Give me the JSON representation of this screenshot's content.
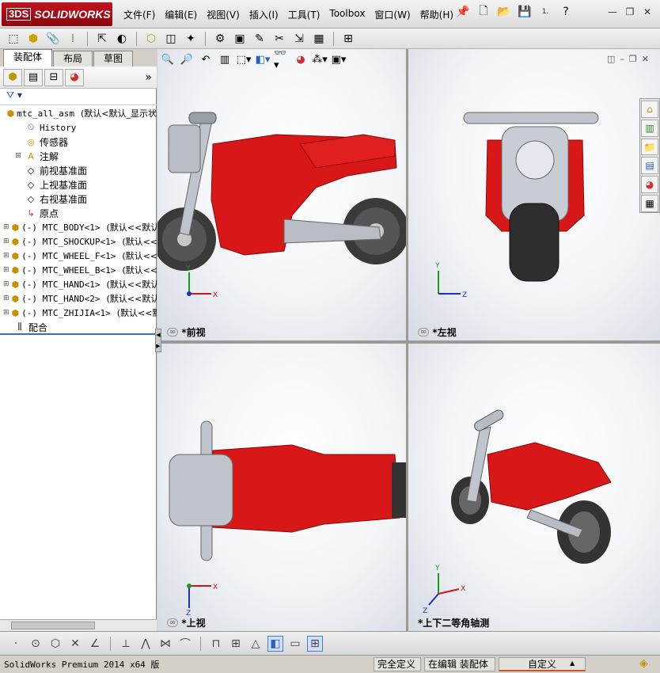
{
  "app": {
    "logo_ds": "3DS",
    "logo_text": "SOLIDWORKS"
  },
  "menu": [
    "文件(F)",
    "编辑(E)",
    "视图(V)",
    "插入(I)",
    "工具(T)",
    "Toolbox",
    "窗口(W)",
    "帮助(H)"
  ],
  "menu_extra": "1.",
  "panel": {
    "tabs": [
      "装配体",
      "布局",
      "草图"
    ],
    "more": "»",
    "tree": [
      {
        "name": "mtc_all_asm",
        "cfg": "(默认<默认_显示状",
        "expand": "",
        "icon": "assembly-icon",
        "mono": true
      },
      {
        "name": "History",
        "cfg": "",
        "expand": "",
        "icon": "history-icon",
        "mono": true,
        "indent": 1
      },
      {
        "name": "传感器",
        "cfg": "",
        "expand": "",
        "icon": "sensor-icon",
        "indent": 1
      },
      {
        "name": "注解",
        "cfg": "",
        "expand": "⊞",
        "icon": "annotation-icon",
        "indent": 1
      },
      {
        "name": "前视基准面",
        "cfg": "",
        "expand": "",
        "icon": "plane-icon",
        "indent": 1
      },
      {
        "name": "上视基准面",
        "cfg": "",
        "expand": "",
        "icon": "plane-icon",
        "indent": 1
      },
      {
        "name": "右视基准面",
        "cfg": "",
        "expand": "",
        "icon": "plane-icon",
        "indent": 1
      },
      {
        "name": "原点",
        "cfg": "",
        "expand": "",
        "icon": "origin-icon",
        "indent": 1
      },
      {
        "name": "(-) MTC_BODY<1>",
        "cfg": "(默认<<默认",
        "expand": "⊞",
        "icon": "part-icon",
        "mono": true
      },
      {
        "name": "(-) MTC_SHOCKUP<1>",
        "cfg": "(默认<<默",
        "expand": "⊞",
        "icon": "part-icon",
        "mono": true
      },
      {
        "name": "(-) MTC_WHEEL_F<1>",
        "cfg": "(默认<<默",
        "expand": "⊞",
        "icon": "part-icon",
        "mono": true
      },
      {
        "name": "(-) MTC_WHEEL_B<1>",
        "cfg": "(默认<<默",
        "expand": "⊞",
        "icon": "part-icon",
        "mono": true
      },
      {
        "name": "(-) MTC_HAND<1>",
        "cfg": "(默认<<默认",
        "expand": "⊞",
        "icon": "part-icon",
        "mono": true
      },
      {
        "name": "(-) MTC_HAND<2>",
        "cfg": "(默认<<默认",
        "expand": "⊞",
        "icon": "part-icon",
        "mono": true
      },
      {
        "name": "(-) MTC_ZHIJIA<1>",
        "cfg": "(默认<<默",
        "expand": "⊞",
        "icon": "part-icon",
        "mono": true
      },
      {
        "name": "配合",
        "cfg": "",
        "expand": "",
        "icon": "mate-icon"
      }
    ]
  },
  "views": {
    "front": "*前视",
    "left": "*左视",
    "top": "*上视",
    "iso": "*上下二等角轴测"
  },
  "axes": {
    "x": "X",
    "y": "Y",
    "z": "Z"
  },
  "status": {
    "app": "SolidWorks Premium 2014 x64 版",
    "defined": "完全定义",
    "editing": "在编辑 装配体",
    "custom": "自定义",
    "arrow": "▲"
  },
  "colors": {
    "body_red": "#d81818",
    "accent_blue": "#3a6cc0"
  }
}
